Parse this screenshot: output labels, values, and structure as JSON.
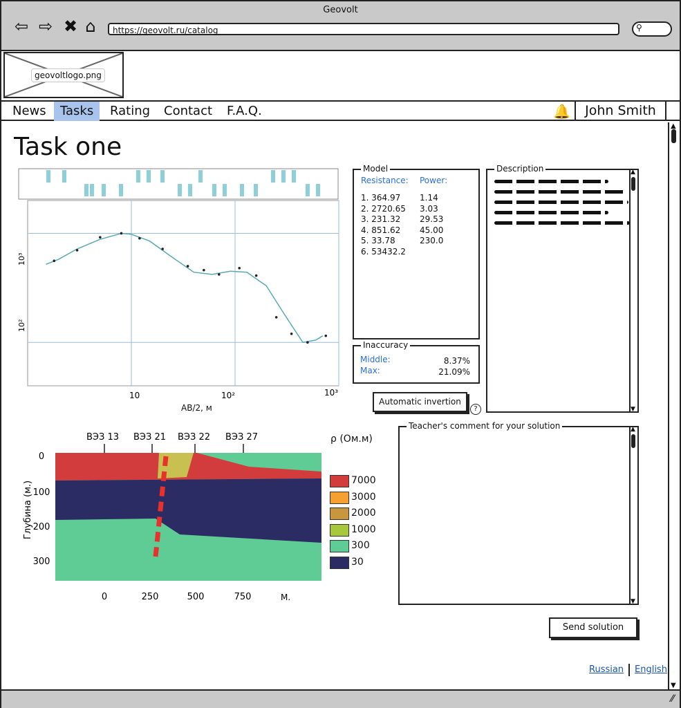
{
  "window": {
    "title": "Geovolt"
  },
  "browser": {
    "url": "https://geovolt.ru/catalog"
  },
  "logo": {
    "label": "geovoltlogo.png"
  },
  "menu": {
    "items": [
      "News",
      "Tasks",
      "Rating",
      "Contact",
      "F.A.Q."
    ],
    "active": "Tasks"
  },
  "user": {
    "name": "John Smith"
  },
  "page": {
    "title": "Task one"
  },
  "chart_data": {
    "type": "line",
    "xscale": "log",
    "yscale": "log",
    "xlabel": "AB/2, м",
    "ylabel": "",
    "x_ticks": [
      "10",
      "10²",
      "10³"
    ],
    "y_ticks": [
      "10³",
      "10²"
    ],
    "xlim": [
      1,
      1000
    ],
    "ylim": [
      40,
      2000
    ],
    "series": [
      {
        "values": [
          [
            1.5,
            520
          ],
          [
            2,
            580
          ],
          [
            3,
            720
          ],
          [
            5,
            880
          ],
          [
            8,
            1000
          ],
          [
            10,
            980
          ],
          [
            15,
            850
          ],
          [
            25,
            600
          ],
          [
            40,
            440
          ],
          [
            60,
            420
          ],
          [
            90,
            450
          ],
          [
            130,
            440
          ],
          [
            200,
            330
          ],
          [
            300,
            180
          ],
          [
            450,
            100
          ],
          [
            600,
            105
          ],
          [
            700,
            115
          ]
        ]
      }
    ],
    "points": [
      [
        1.8,
        560
      ],
      [
        3,
        700
      ],
      [
        5,
        920
      ],
      [
        8,
        1000
      ],
      [
        12,
        900
      ],
      [
        20,
        720
      ],
      [
        35,
        500
      ],
      [
        50,
        460
      ],
      [
        70,
        420
      ],
      [
        110,
        480
      ],
      [
        160,
        410
      ],
      [
        250,
        170
      ],
      [
        350,
        120
      ],
      [
        500,
        100
      ],
      [
        750,
        115
      ]
    ]
  },
  "geo_section": {
    "stations": [
      "ВЭЗ 13",
      "ВЭЗ 21",
      "ВЭЗ 22",
      "ВЭЗ 27"
    ],
    "depth_label": "Глубина (м.)",
    "depth_ticks": [
      "0",
      "100",
      "200",
      "300"
    ],
    "x_ticks": [
      "0",
      "250",
      "500",
      "750"
    ],
    "x_unit": "М.",
    "legend_title": "ρ (Ом.м)",
    "legend": [
      {
        "value": "7000",
        "color": "#d23c3c"
      },
      {
        "value": "3000",
        "color": "#f5a030"
      },
      {
        "value": "2000",
        "color": "#c8963c"
      },
      {
        "value": "1000",
        "color": "#a8c83c"
      },
      {
        "value": "300",
        "color": "#5fcc96"
      },
      {
        "value": "30",
        "color": "#2c2c64"
      }
    ]
  },
  "model": {
    "legend": "Model",
    "resistance_header": "Resistance:",
    "power_header": "Power:",
    "resistance": [
      "1. 364.97",
      "2. 2720.65",
      "3. 231.32",
      "4. 851.62",
      "5. 33.78",
      "6. 53432.2"
    ],
    "power": [
      "1.14",
      "3.03",
      "29.53",
      "45.00",
      "230.0"
    ]
  },
  "inaccuracy": {
    "legend": "Inaccuracy",
    "middle_label": "Middle:",
    "middle_value": "8.37%",
    "max_label": "Max:",
    "max_value": "21.09%"
  },
  "description": {
    "legend": "Description"
  },
  "buttons": {
    "auto_inversion": "Automatic invertion",
    "help": "?",
    "send": "Send solution"
  },
  "teacher_comment": {
    "legend": "Teacher's comment for your solution"
  },
  "languages": {
    "russian": "Russian",
    "english": "English"
  }
}
